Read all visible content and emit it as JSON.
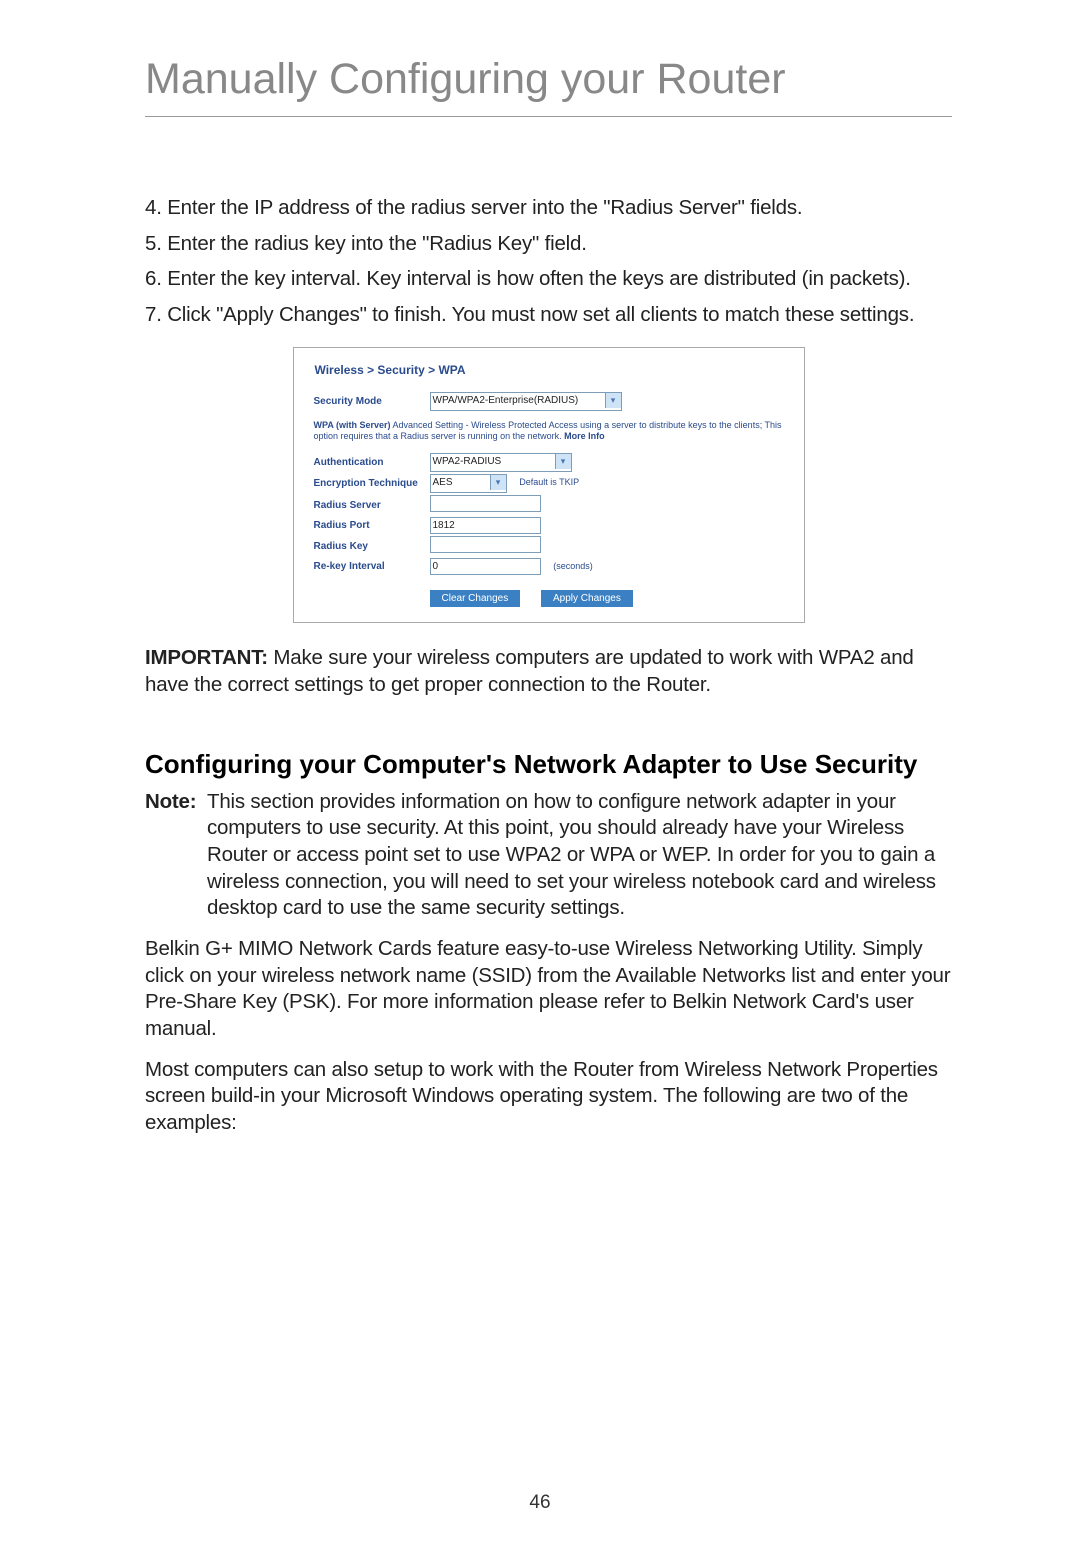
{
  "title": "Manually Configuring your Router",
  "steps": [
    "4. Enter the IP address of the radius server into the \"Radius Server\" fields.",
    "5. Enter the radius key into the \"Radius Key\" field.",
    "6. Enter the key interval. Key interval is how often the keys are distributed (in packets).",
    "7. Click \"Apply Changes\" to finish. You must now set all clients to match these settings."
  ],
  "router_ui": {
    "breadcrumb": "Wireless > Security > WPA",
    "security_mode_label": "Security Mode",
    "security_mode_value": "WPA/WPA2-Enterprise(RADIUS)",
    "wpa_note_bold": "WPA (with Server)",
    "wpa_note_rest": " Advanced Setting - Wireless Protected Access using a server to distribute keys to the clients; This option requires that a Radius server is running on the network. ",
    "more_info": "More Info",
    "auth_label": "Authentication",
    "auth_value": "WPA2-RADIUS",
    "enc_label": "Encryption Technique",
    "enc_value": "AES",
    "enc_default": "Default is TKIP",
    "radius_server_label": "Radius Server",
    "radius_server_value": "",
    "radius_port_label": "Radius Port",
    "radius_port_value": "1812",
    "radius_key_label": "Radius Key",
    "radius_key_value": "",
    "rekey_label": "Re-key Interval",
    "rekey_value": "0",
    "rekey_unit": "(seconds)",
    "clear_btn": "Clear Changes",
    "apply_btn": "Apply Changes"
  },
  "important_label": "IMPORTANT:",
  "important_text": " Make sure your wireless computers are updated to work with WPA2 and have the correct settings to get proper connection to the Router.",
  "subhead": "Configuring your Computer's Network Adapter to Use Security",
  "note_label": "Note:",
  "note_text": "This section provides information on how to configure network adapter in your computers to use security. At this point, you should already have your Wireless Router or access point set to use WPA2 or WPA or WEP. In order for you to gain a wireless connection, you will need to set your wireless notebook card and wireless desktop card to use the same security settings.",
  "para_belkin": "Belkin G+ MIMO Network Cards feature easy-to-use Wireless Networking Utility. Simply click on your wireless network name (SSID) from the Available Networks list and enter your Pre-Share Key (PSK). For more information please refer to Belkin Network Card's user manual.",
  "para_most": "Most computers can also setup to work with the Router from Wireless Network Properties screen build-in your Microsoft Windows operating system. The following are two of the examples:",
  "page_number": "46"
}
